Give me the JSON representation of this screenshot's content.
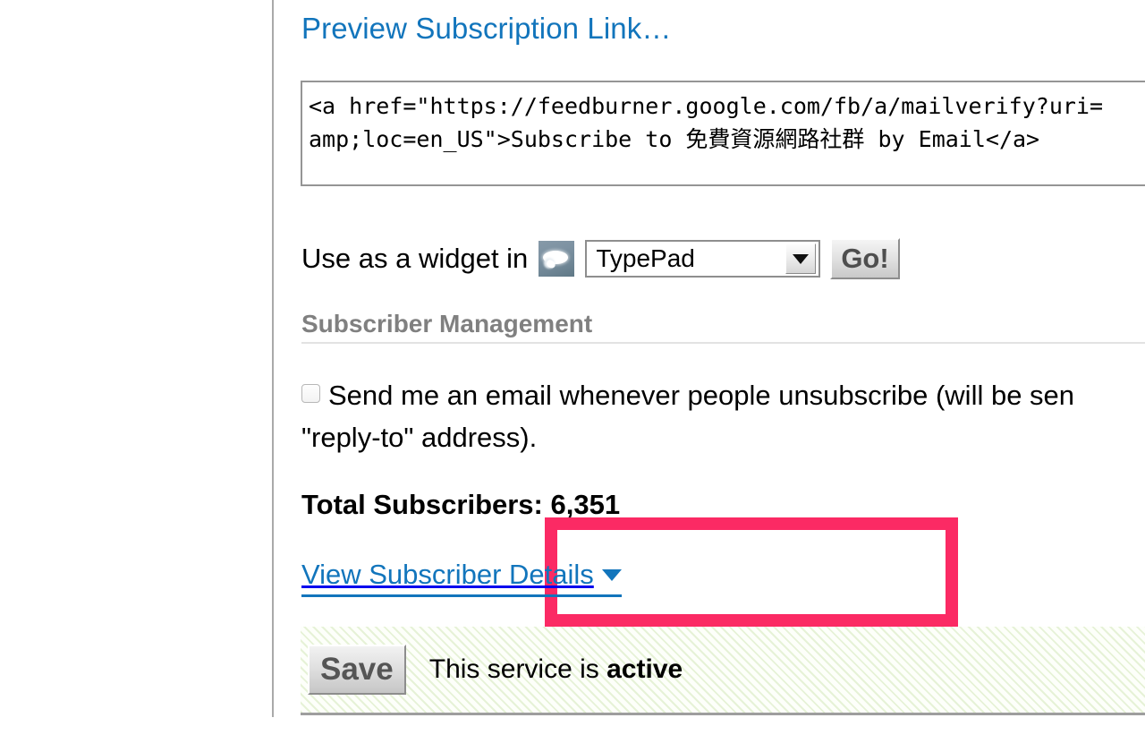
{
  "preview": {
    "link_label": "Preview Subscription Link…"
  },
  "code_box": {
    "line1": "<a href=\"https://feedburner.google.com/fb/a/mailverify?uri=",
    "line2": "amp;loc=en_US\">Subscribe to 免費資源網路社群 by Email</a>"
  },
  "widget": {
    "label": "Use as a widget in",
    "icon": "typepad-cloud-icon",
    "selected_platform": "TypePad",
    "dropdown_icon": "chevron-down-icon",
    "go_label": "Go!"
  },
  "subscriber_management": {
    "heading": "Subscriber Management",
    "unsubscribe_notice_label_line1": "Send me an email whenever people unsubscribe (will be sen",
    "unsubscribe_notice_label_line2": "\"reply-to\" address).",
    "checkbox_checked": false,
    "total_subscribers_label": "Total Subscribers: 6,351",
    "view_details_label": "View Subscriber Details",
    "view_details_caret": "caret-down-icon"
  },
  "annotation": {
    "highlight_color": "#fb2a64",
    "target": "view-subscriber-details"
  },
  "save_bar": {
    "save_label": "Save",
    "status_prefix": "This service is ",
    "status_value": "active"
  },
  "colors": {
    "link_blue": "#1275bc",
    "heading_gray": "#808080",
    "highlight_pink": "#fb2a64",
    "stripe_green": "#96c45a"
  }
}
